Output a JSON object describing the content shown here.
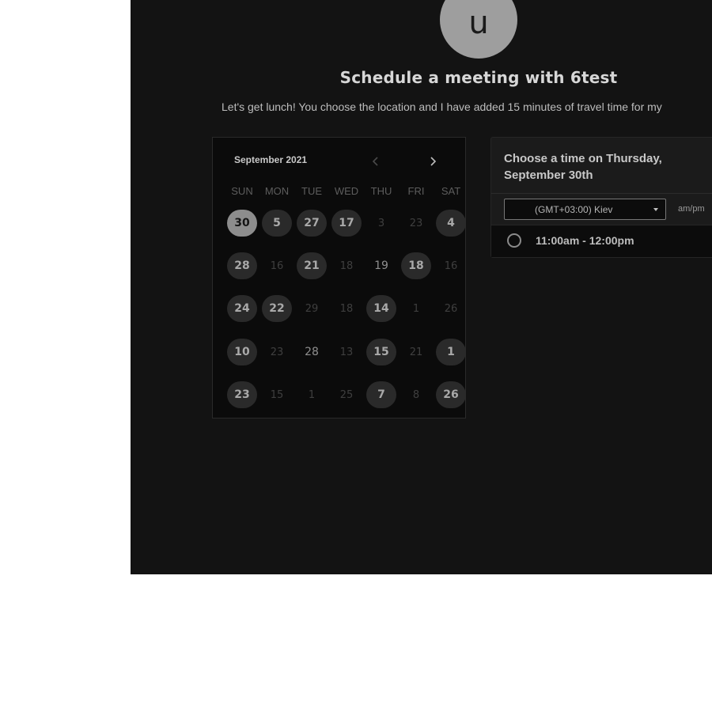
{
  "avatar": {
    "initial": "u"
  },
  "header": {
    "title": "Schedule a meeting with 6test",
    "description": "Let's get lunch! You choose the location and I have added 15 minutes of travel time for my"
  },
  "calendar": {
    "month_label": "September 2021",
    "prev_icon": "chevron-left-icon",
    "next_icon": "chevron-right-icon",
    "weekdays": [
      "SUN",
      "MON",
      "TUE",
      "WED",
      "THU",
      "FRI",
      "SAT"
    ],
    "weeks": [
      [
        {
          "d": "30",
          "s": "sel"
        },
        {
          "d": "5",
          "s": "avail"
        },
        {
          "d": "27",
          "s": "avail"
        },
        {
          "d": "17",
          "s": "avail"
        },
        {
          "d": "3",
          "s": "dim"
        },
        {
          "d": "23",
          "s": "dim"
        },
        {
          "d": "4",
          "s": "avail"
        }
      ],
      [
        {
          "d": "28",
          "s": "avail"
        },
        {
          "d": "16",
          "s": "dim"
        },
        {
          "d": "21",
          "s": "avail"
        },
        {
          "d": "18",
          "s": "dim"
        },
        {
          "d": "19",
          "s": "plain"
        },
        {
          "d": "18",
          "s": "avail"
        },
        {
          "d": "16",
          "s": "dim"
        }
      ],
      [
        {
          "d": "24",
          "s": "avail"
        },
        {
          "d": "22",
          "s": "avail"
        },
        {
          "d": "29",
          "s": "dim"
        },
        {
          "d": "18",
          "s": "dim"
        },
        {
          "d": "14",
          "s": "avail"
        },
        {
          "d": "1",
          "s": "dim"
        },
        {
          "d": "26",
          "s": "dim"
        }
      ],
      [
        {
          "d": "10",
          "s": "avail"
        },
        {
          "d": "23",
          "s": "dim"
        },
        {
          "d": "28",
          "s": "plain"
        },
        {
          "d": "13",
          "s": "dim"
        },
        {
          "d": "15",
          "s": "avail"
        },
        {
          "d": "21",
          "s": "dim"
        },
        {
          "d": "1",
          "s": "avail"
        }
      ],
      [
        {
          "d": "23",
          "s": "avail"
        },
        {
          "d": "15",
          "s": "dim"
        },
        {
          "d": "1",
          "s": "dim"
        },
        {
          "d": "25",
          "s": "dim"
        },
        {
          "d": "7",
          "s": "avail"
        },
        {
          "d": "8",
          "s": "dim"
        },
        {
          "d": "26",
          "s": "avail"
        }
      ]
    ]
  },
  "time_panel": {
    "heading": "Choose a time on Thursday, September 30th",
    "timezone": "(GMT+03:00) Kiev",
    "format_toggle": "am/pm",
    "slots": [
      "11:00am - 12:00pm"
    ]
  },
  "colors": {
    "background": "#131313",
    "selected_day": "#8d8d8d",
    "available_day": "#2a2a2a"
  }
}
